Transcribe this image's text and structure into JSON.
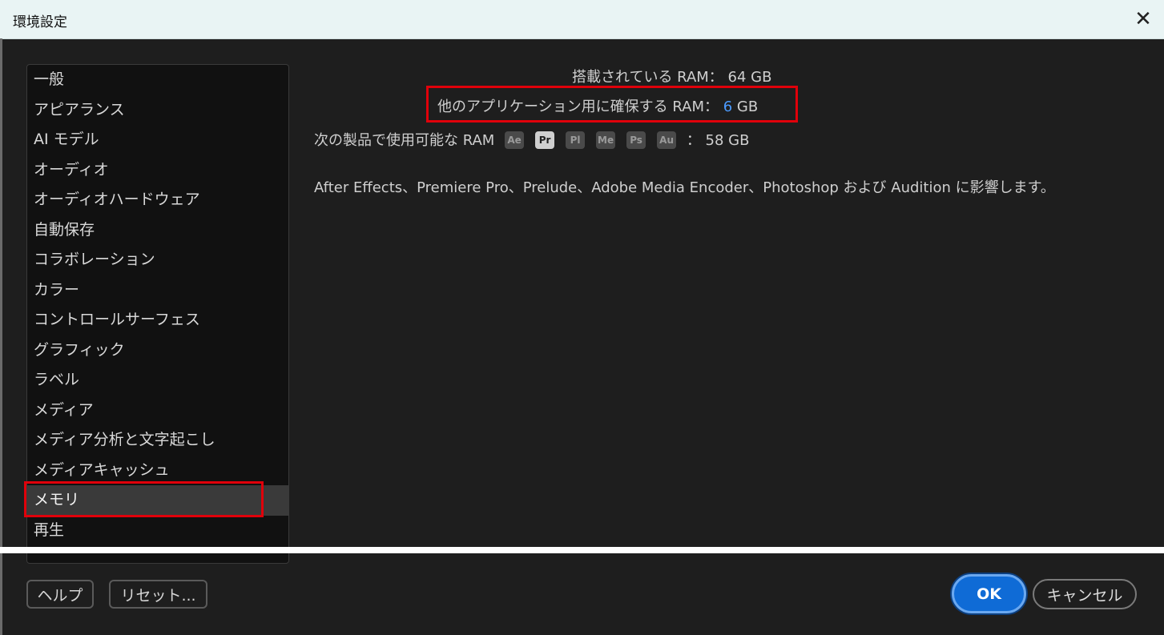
{
  "window": {
    "title": "環境設定",
    "close_glyph": "✕"
  },
  "sidebar": {
    "items": [
      {
        "label": "一般"
      },
      {
        "label": "アピアランス"
      },
      {
        "label": "AI モデル"
      },
      {
        "label": "オーディオ"
      },
      {
        "label": "オーディオハードウェア"
      },
      {
        "label": "自動保存"
      },
      {
        "label": "コラボレーション"
      },
      {
        "label": "カラー"
      },
      {
        "label": "コントロールサーフェス"
      },
      {
        "label": "グラフィック"
      },
      {
        "label": "ラベル"
      },
      {
        "label": "メディア"
      },
      {
        "label": "メディア分析と文字起こし"
      },
      {
        "label": "メディアキャッシュ"
      },
      {
        "label": "メモリ"
      },
      {
        "label": "再生"
      }
    ],
    "selected": "メモリ"
  },
  "memory": {
    "installed_label": "搭載されている RAM：",
    "installed_value": "64 GB",
    "reserved_label": "他のアプリケーション用に確保する RAM：",
    "reserved_value": "6",
    "reserved_unit": "GB",
    "available_label": "次の製品で使用可能な RAM",
    "products": [
      "Ae",
      "Pr",
      "Pl",
      "Me",
      "Ps",
      "Au"
    ],
    "active_product": "Pr",
    "available_sep": "：",
    "available_value": "58 GB",
    "info": "After Effects、Premiere Pro、Prelude、Adobe Media Encoder、Photoshop および Audition に影響します。"
  },
  "footer": {
    "help_label": "ヘルプ",
    "reset_label": "リセット...",
    "ok_label": "OK",
    "cancel_label": "キャンセル"
  },
  "colors": {
    "accent": "#0f6bd6",
    "highlight": "#e0000a",
    "value_blue": "#4b9bff"
  }
}
